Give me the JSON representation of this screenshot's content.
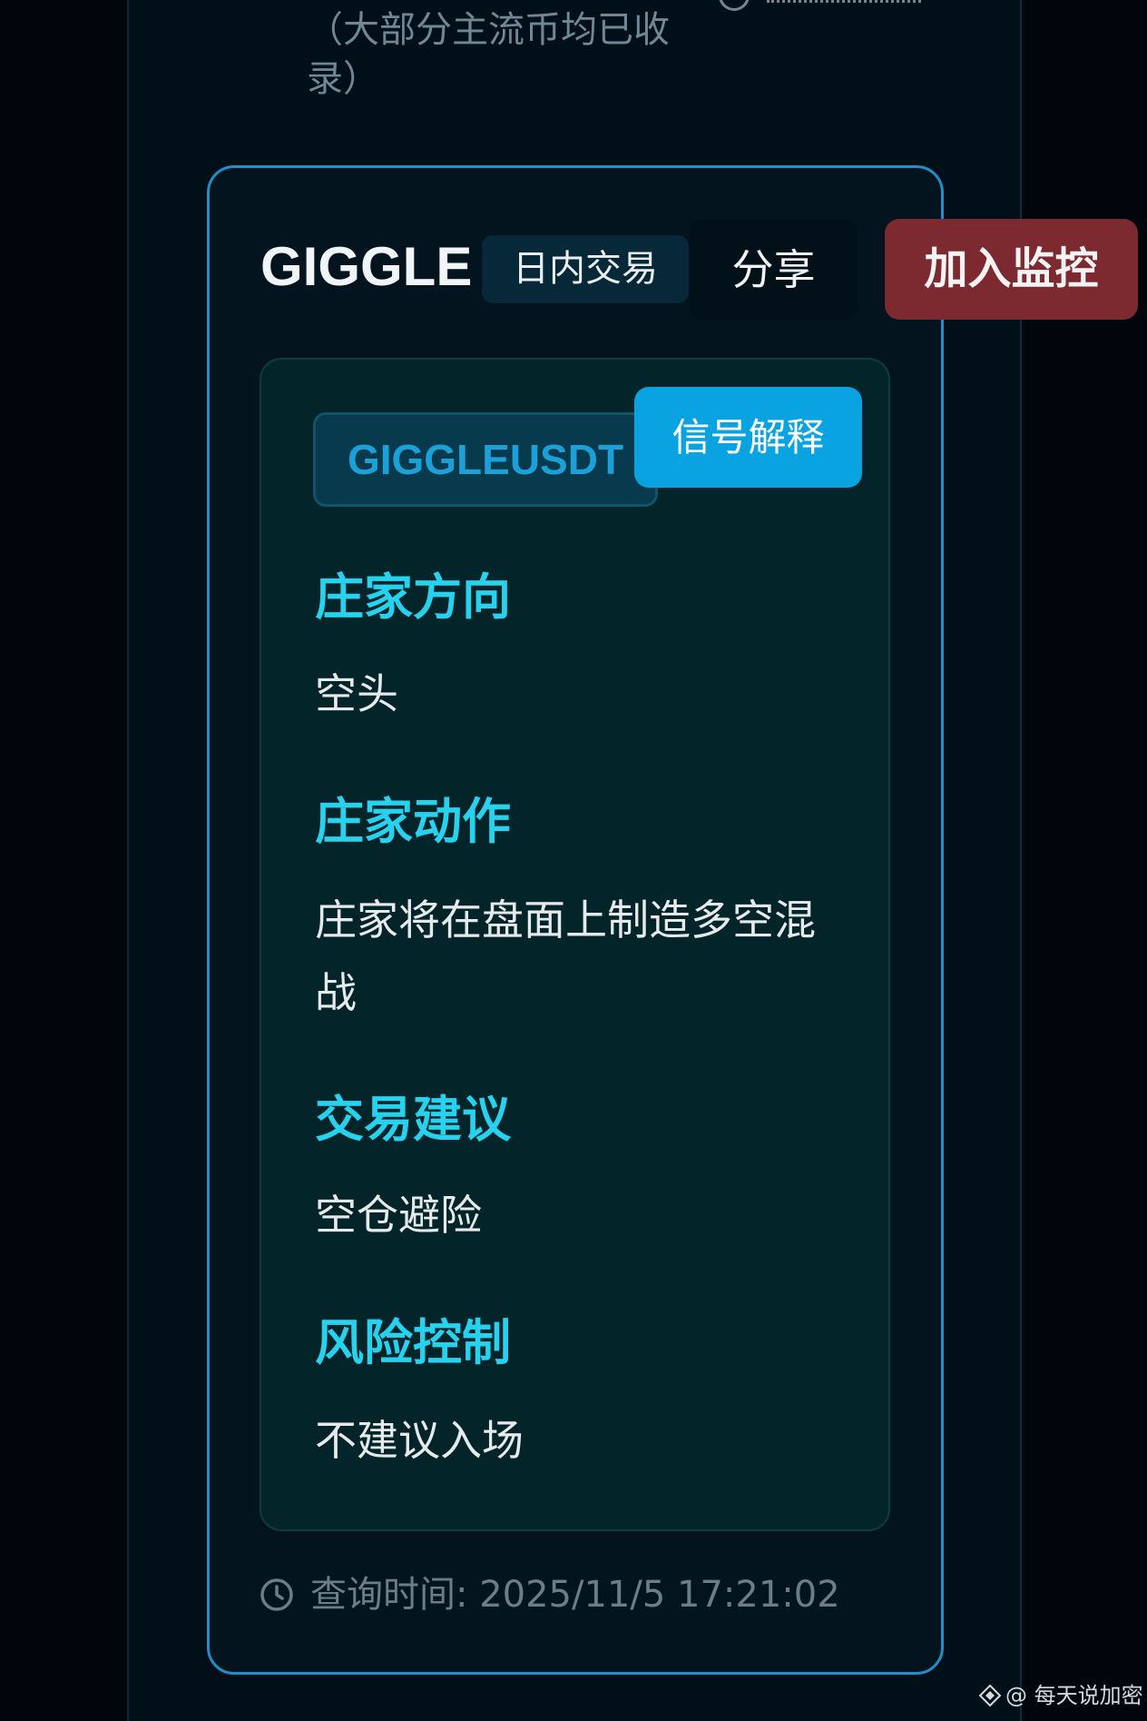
{
  "previous_card": {
    "text": "（大部分主流币均已收录）"
  },
  "card": {
    "title": "GIGGLE",
    "tag": "日内交易",
    "share_label": "分享",
    "monitor_label": "加入监控",
    "symbol": "GIGGLEUSDT",
    "explain_label": "信号解释",
    "sections": [
      {
        "heading": "庄家方向",
        "value": "空头"
      },
      {
        "heading": "庄家动作",
        "value": "庄家将在盘面上制造多空混战"
      },
      {
        "heading": "交易建议",
        "value": "空仓避险"
      },
      {
        "heading": "风险控制",
        "value": "不建议入场"
      }
    ],
    "query_time": "查询时间: 2025/11/5 17:21:02"
  },
  "watermark": {
    "text": "@ 每天说加密",
    "icon": "binance-square-icon"
  },
  "colors": {
    "accent": "#1e8fc8",
    "heading": "#27d2ee",
    "explain_button": "#0aa3e2",
    "monitor_button": "#7c2a2f"
  }
}
